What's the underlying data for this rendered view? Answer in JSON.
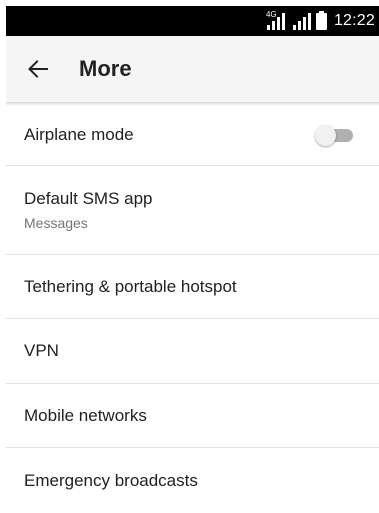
{
  "status_bar": {
    "network_type": "4G",
    "time": "12:22",
    "icons": [
      "signal-4g-icon",
      "signal-icon",
      "battery-icon"
    ]
  },
  "app_bar": {
    "back_icon": "arrow-left-icon",
    "title": "More"
  },
  "items": [
    {
      "title": "Airplane mode",
      "toggle": "off"
    },
    {
      "title": "Default SMS app",
      "subtitle": "Messages"
    },
    {
      "title": "Tethering & portable hotspot"
    },
    {
      "title": "VPN"
    },
    {
      "title": "Mobile networks"
    },
    {
      "title": "Emergency broadcasts"
    }
  ],
  "colors": {
    "status_bar": "#000000",
    "app_bar": "#f5f5f5",
    "divider": "#e2e2e2",
    "toggle_track_off": "#b0b0b0"
  }
}
